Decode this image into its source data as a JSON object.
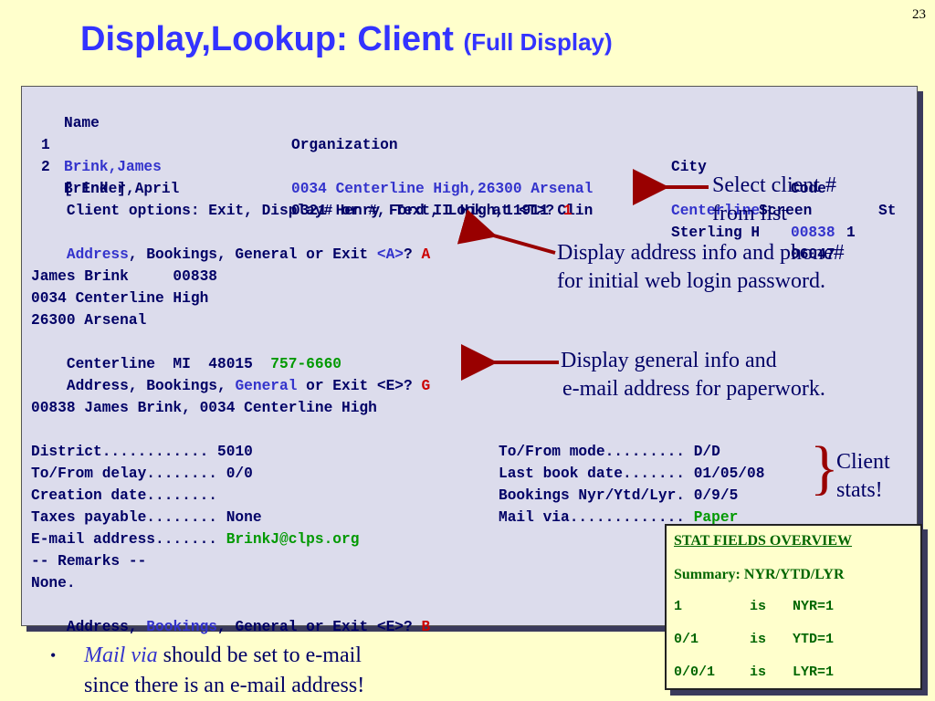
{
  "page_number": "23",
  "title": {
    "main": "Display,Lookup: Client",
    "sub": "(Full Display)"
  },
  "terminal": {
    "header": {
      "name": "Name",
      "organization": "Organization",
      "city": "City",
      "code": "Code",
      "st": "St"
    },
    "rows": [
      {
        "num": "1",
        "name": "Brink,James",
        "org": "0034 Centerline High,26300 Arsenal",
        "city": "Centerline",
        "code": "00838"
      },
      {
        "num": "2",
        "name": "Brinker,April",
        "org": "0321 Henry Ford II High,11911 Clin",
        "city": "Sterling H",
        "code": "06047"
      }
    ],
    "end_marker": "[ End ]",
    "screen_label": "Screen",
    "screen_num": "1",
    "client_options_prompt": "Client options: Exit, Display# or #, Text, Look at <T>?",
    "client_options_answer": "1",
    "menu1": {
      "address": "Address",
      "rest": ", Bookings, General or Exit",
      "default": "<A>",
      "q": "?",
      "answer": "A"
    },
    "addr": {
      "line1": "James Brink     00838",
      "line2": "0034 Centerline High",
      "line3": "26300 Arsenal",
      "line4": "Centerline  MI  48015",
      "phone": "757-6660"
    },
    "menu2": {
      "before": "Address, Bookings,",
      "general": "General",
      "after": "or Exit <E>?",
      "answer": "G"
    },
    "general_header": "00838 James Brink, 0034 Centerline High",
    "fields_left": [
      {
        "label": "District............",
        "value": "5010"
      },
      {
        "label": "To/From delay........",
        "value": "0/0"
      },
      {
        "label": "Creation date........",
        "value": ""
      },
      {
        "label": "Taxes payable........",
        "value": "None"
      },
      {
        "label": "E-mail address.......",
        "value": "BrinkJ@clps.org"
      }
    ],
    "fields_right": [
      {
        "label": "To/From mode.........",
        "value": "D/D"
      },
      {
        "label": "Last book date.......",
        "value": "01/05/08"
      },
      {
        "label": "Bookings Nyr/Ytd/Lyr.",
        "value": "0/9/5"
      },
      {
        "label": "Mail via.............",
        "value": "Paper"
      }
    ],
    "remarks_header": "-- Remarks --",
    "remarks": "None.",
    "menu3": {
      "before": "Address,",
      "bookings": "Bookings",
      "after": ", General or Exit <E>?",
      "answer": "B"
    }
  },
  "annotations": {
    "a1": [
      "Select client #",
      "from list"
    ],
    "a2": [
      "Display address info and phone#",
      "for initial web login password."
    ],
    "a3": [
      "Display general info and",
      "e-mail address for paperwork."
    ],
    "a4": [
      "Client",
      "stats!"
    ]
  },
  "stats_box": {
    "header": "STAT FIELDS OVERVIEW",
    "summary": "Summary: NYR/YTD/LYR",
    "rows": [
      {
        "code": "1",
        "is": "is",
        "meaning": "NYR=1"
      },
      {
        "code": "0/1",
        "is": "is",
        "meaning": "YTD=1"
      },
      {
        "code": "0/0/1",
        "is": "is",
        "meaning": "LYR=1"
      }
    ]
  },
  "bullet": {
    "italic": "Mail via",
    "line1_rest": "should be set to e-mail",
    "line2": "since there is an e-mail address!"
  },
  "colors": {
    "background": "#ffffcc",
    "title": "#3333ff",
    "arrow": "#990000",
    "terminal_bg": "#dcdcec"
  }
}
